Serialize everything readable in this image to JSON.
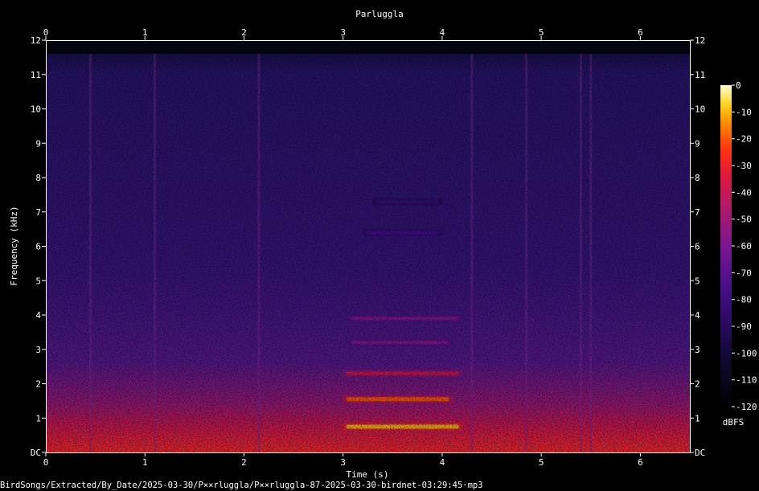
{
  "chart_data": {
    "type": "heatmap",
    "title": "Parluggla",
    "xlabel": "Time (s)",
    "ylabel": "Frequency (kHz)",
    "xlim": [
      0,
      6.5
    ],
    "ylim": [
      0,
      12
    ],
    "x_ticks": [
      "0",
      "1",
      "2",
      "3",
      "4",
      "5",
      "6"
    ],
    "y_ticks": [
      "DC",
      "1",
      "2",
      "3",
      "4",
      "5",
      "6",
      "7",
      "8",
      "9",
      "10",
      "11",
      "12"
    ],
    "colorbar": {
      "label": "dBFS",
      "range": [
        -120,
        0
      ],
      "ticks": [
        "0",
        "-10",
        "-20",
        "-30",
        "-40",
        "-50",
        "-60",
        "-70",
        "-80",
        "-90",
        "-100",
        "-110",
        "-120"
      ]
    },
    "noise_floor_top_khz": 11.6,
    "calls": [
      {
        "t_start": 3.0,
        "t_end": 4.2,
        "freq_khz": 0.75,
        "level_db": -10
      },
      {
        "t_start": 3.0,
        "t_end": 4.1,
        "freq_khz": 1.55,
        "level_db": -20
      },
      {
        "t_start": 3.0,
        "t_end": 4.2,
        "freq_khz": 2.3,
        "level_db": -35
      },
      {
        "t_start": 3.05,
        "t_end": 4.1,
        "freq_khz": 3.2,
        "level_db": -55
      },
      {
        "t_start": 3.05,
        "t_end": 4.2,
        "freq_khz": 3.9,
        "level_db": -55
      },
      {
        "t_start": 3.2,
        "t_end": 4.0,
        "freq_khz": 6.4,
        "level_db": -75
      },
      {
        "t_start": 3.3,
        "t_end": 4.0,
        "freq_khz": 7.3,
        "level_db": -80
      }
    ],
    "vertical_streaks_s": [
      0.45,
      1.1,
      2.15,
      4.3,
      4.85,
      5.4,
      5.5
    ]
  },
  "footer": "BirdSongs/Extracted/By_Date/2025-03-30/P××rluggla/P××rluggla-87-2025-03-30-birdnet-03:29:45·mp3"
}
